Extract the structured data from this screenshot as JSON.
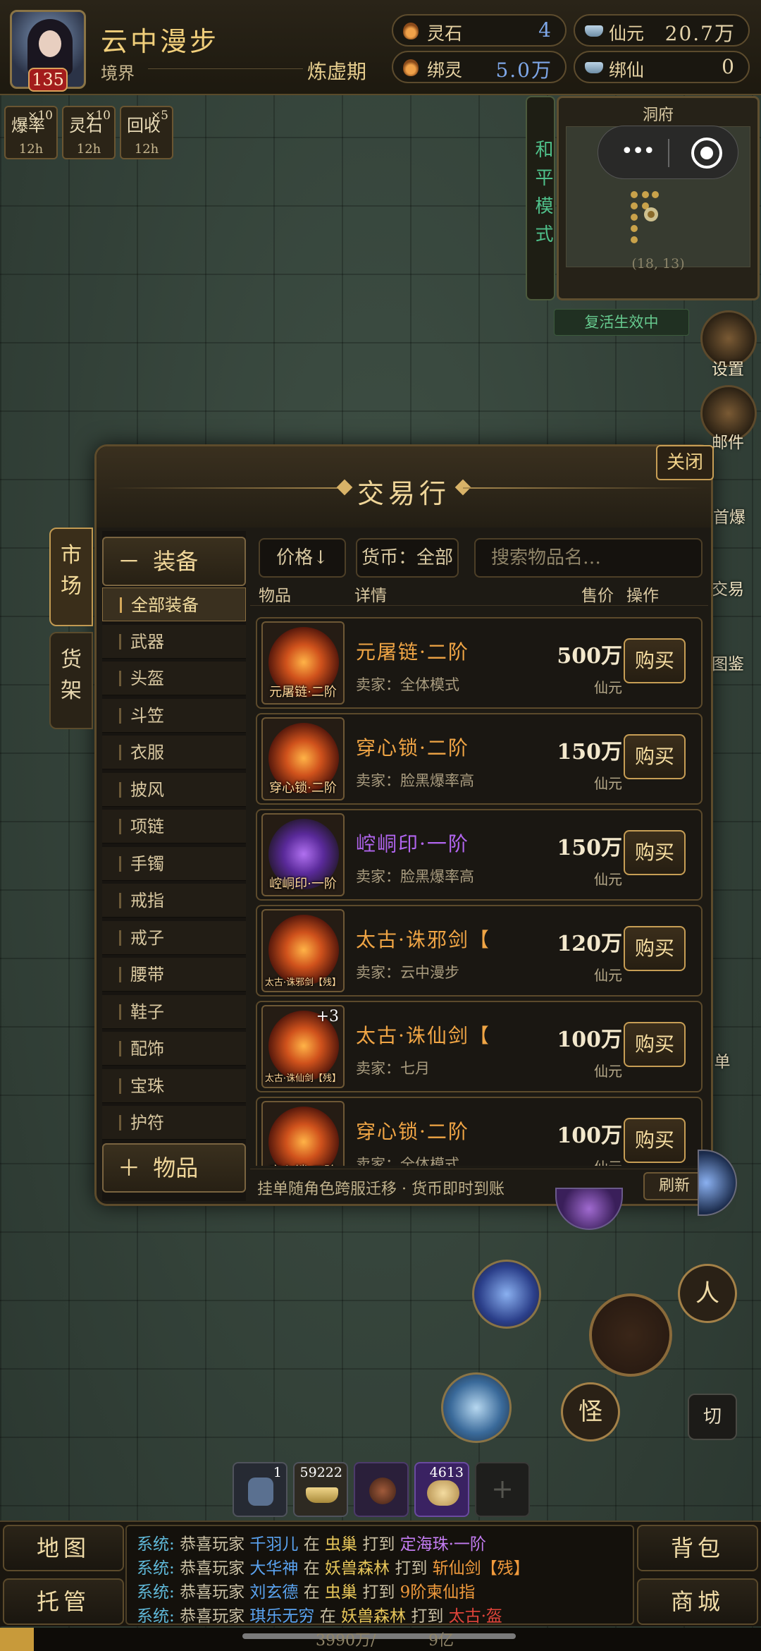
{
  "player": {
    "name": "云中漫步",
    "level": "135",
    "realm_label": "境界",
    "realm_value": "炼虚期"
  },
  "resources": [
    {
      "label": "灵石",
      "value": "4",
      "icon": "spirit-stone-icon"
    },
    {
      "label": "仙元",
      "value": "20.7万",
      "icon": "ingot-icon"
    },
    {
      "label": "绑灵",
      "value": "5.0万",
      "icon": "spirit-stone-icon"
    },
    {
      "label": "绑仙",
      "value": "0",
      "icon": "ingot-icon"
    }
  ],
  "buffs": [
    {
      "name": "爆率",
      "count": "×10",
      "time": "12h"
    },
    {
      "name": "灵石",
      "count": "×10",
      "time": "12h"
    },
    {
      "name": "回收",
      "count": "×5",
      "time": "12h"
    }
  ],
  "mode": {
    "peace": "和平模式"
  },
  "minimap": {
    "title": "洞府",
    "coord": "(18, 13)"
  },
  "revive_status": "复活生效中",
  "side_buttons": [
    "设置",
    "邮件",
    "首爆",
    "交易",
    "图鉴"
  ],
  "side_button_partial": "单",
  "market": {
    "title": "交易行",
    "close_label": "关闭",
    "tabs": [
      "市场",
      "货架"
    ],
    "category_head": "装备",
    "category_head_symbol": "－",
    "categories": [
      "全部装备",
      "武器",
      "头盔",
      "斗笠",
      "衣服",
      "披风",
      "项链",
      "手镯",
      "戒指",
      "戒子",
      "腰带",
      "鞋子",
      "配饰",
      "宝珠",
      "护符"
    ],
    "items_head": "物品",
    "items_head_symbol": "＋",
    "sort_label": "价格↓",
    "currency_filter": "货币：全部",
    "search_placeholder": "搜索物品名…",
    "columns": {
      "item": "物品",
      "detail": "详情",
      "price": "售价",
      "action": "操作"
    },
    "buy_label": "购买",
    "listings": [
      {
        "name": "元屠链·二阶",
        "thumb_caption": "元屠链·二阶",
        "seller": "卖家：全体模式",
        "price": "500万",
        "currency": "仙元",
        "rarity": "orange",
        "plus": ""
      },
      {
        "name": "穿心锁·二阶",
        "thumb_caption": "穿心锁·二阶",
        "seller": "卖家：脸黑爆率高",
        "price": "150万",
        "currency": "仙元",
        "rarity": "orange",
        "plus": ""
      },
      {
        "name": "崆峒印·一阶",
        "thumb_caption": "崆峒印·一阶",
        "seller": "卖家：脸黑爆率高",
        "price": "150万",
        "currency": "仙元",
        "rarity": "purple",
        "plus": ""
      },
      {
        "name": "太古·诛邪剑【",
        "thumb_caption": "太古·诛邪剑【残】",
        "seller": "卖家：云中漫步",
        "price": "120万",
        "currency": "仙元",
        "rarity": "orange",
        "plus": ""
      },
      {
        "name": "太古·诛仙剑【",
        "thumb_caption": "太古·诛仙剑【残】",
        "seller": "卖家：七月",
        "price": "100万",
        "currency": "仙元",
        "rarity": "orange",
        "plus": "+3"
      },
      {
        "name": "穿心锁·二阶",
        "thumb_caption": "穿心锁·二阶",
        "seller": "卖家：全体模式",
        "price": "100万",
        "currency": "仙元",
        "rarity": "orange",
        "plus": ""
      }
    ],
    "footer_note": "挂单随角色跨服迁移 · 货币即时到账",
    "refresh_label": "刷新"
  },
  "combat_buttons": {
    "person": "人",
    "monster": "怪",
    "switch": "切"
  },
  "quickbar": [
    {
      "icon": "stone-tablet-icon",
      "count": "1"
    },
    {
      "icon": "gold-ingot-icon",
      "count": "59222"
    },
    {
      "icon": "dark-orb-icon",
      "count": ""
    },
    {
      "icon": "treasure-pouch-icon",
      "count": "4613"
    },
    {
      "icon": "add-icon",
      "count": ""
    }
  ],
  "quickbar_add": "+",
  "bottom_buttons": {
    "map": "地图",
    "auto": "托管",
    "bag": "背包",
    "shop": "商城"
  },
  "chat": [
    {
      "prefix": "系统:",
      "pre": "恭喜玩家",
      "name": "千羽儿",
      "at": "在",
      "place": "虫巢",
      "hit": "打到",
      "item": "定海珠·一阶",
      "item_color": "purple"
    },
    {
      "prefix": "系统:",
      "pre": "恭喜玩家",
      "name": "大华神",
      "at": "在",
      "place": "妖兽森林",
      "hit": "打到",
      "item": "斩仙剑【残】",
      "item_color": "orange"
    },
    {
      "prefix": "系统:",
      "pre": "恭喜玩家",
      "name": "刘玄德",
      "at": "在",
      "place": "虫巢",
      "hit": "打到",
      "item": "9阶柬仙指",
      "item_color": "orange"
    },
    {
      "prefix": "系统:",
      "pre": "恭喜玩家",
      "name": "琪乐无穷",
      "at": "在",
      "place": "妖兽森林",
      "hit": "打到",
      "item": "太古·盔",
      "item_color": "red"
    }
  ],
  "status_bar": {
    "left": "3990万/",
    "right": "9亿"
  },
  "colors": {
    "accent_gold": "#f0d699",
    "item_orange": "#f0a545",
    "item_purple": "#b165ef",
    "peace_green": "#4fc08a",
    "chat_name_blue": "#5aa3f0"
  }
}
